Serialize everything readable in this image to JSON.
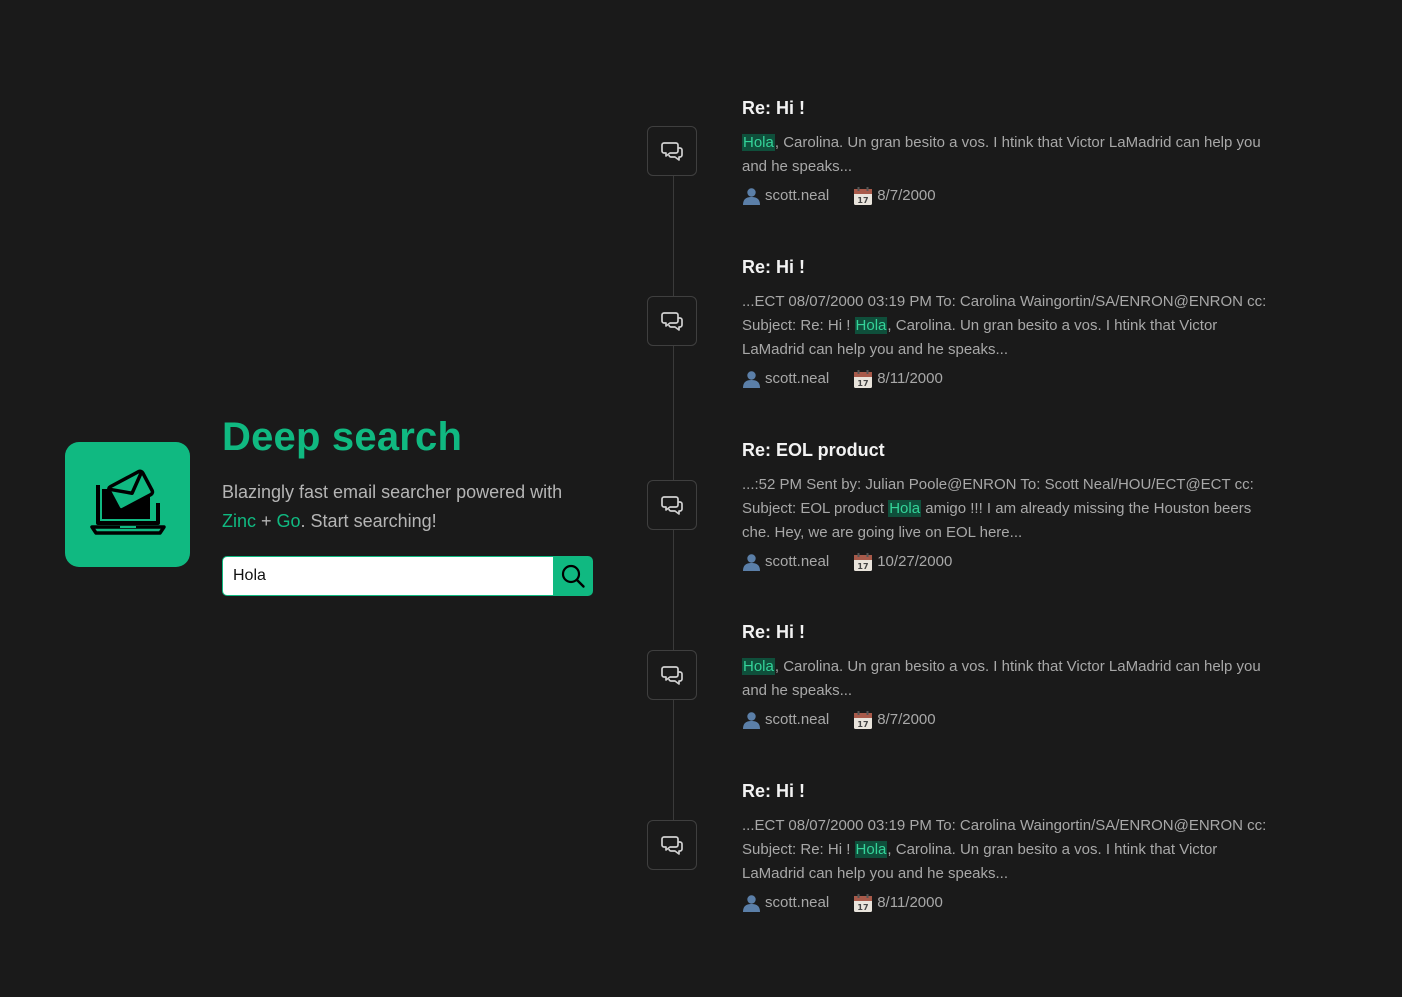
{
  "hero": {
    "title": "Deep search",
    "subtitle_pre": "Blazingly fast email searcher powered with ",
    "link_zinc": "Zinc",
    "plus": " + ",
    "link_go": "Go",
    "subtitle_post": ". Start searching!",
    "logo_icon": "laptop-mail-icon"
  },
  "search": {
    "value": "Hola",
    "button_icon": "search-icon"
  },
  "colors": {
    "accent": "#10b981",
    "background": "#1a1a1a",
    "highlight_bg": "#0f4f3b"
  },
  "results": [
    {
      "title": "Re: Hi !",
      "body_pre": "",
      "highlight": "Hola",
      "body_post": ", Carolina. Un gran besito a vos. I htink that Victor LaMadrid can help you and he speaks...",
      "author": "scott.neal",
      "date": "8/7/2000"
    },
    {
      "title": "Re: Hi !",
      "body_pre": "...ECT 08/07/2000 03:19 PM To: Carolina Waingortin/SA/ENRON@ENRON cc: Subject: Re: Hi ! ",
      "highlight": "Hola",
      "body_post": ", Carolina. Un gran besito a vos. I htink that Victor LaMadrid can help you and he speaks...",
      "author": "scott.neal",
      "date": "8/11/2000"
    },
    {
      "title": "Re: EOL product",
      "body_pre": "...:52 PM Sent by: Julian Poole@ENRON To: Scott Neal/HOU/ECT@ECT cc: Subject: EOL product ",
      "highlight": "Hola",
      "body_post": " amigo !!! I am already missing the Houston beers che. Hey, we are going live on EOL here...",
      "author": "scott.neal",
      "date": "10/27/2000"
    },
    {
      "title": "Re: Hi !",
      "body_pre": "",
      "highlight": "Hola",
      "body_post": ", Carolina. Un gran besito a vos. I htink that Victor LaMadrid can help you and he speaks...",
      "author": "scott.neal",
      "date": "8/7/2000"
    },
    {
      "title": "Re: Hi !",
      "body_pre": "...ECT 08/07/2000 03:19 PM To: Carolina Waingortin/SA/ENRON@ENRON cc: Subject: Re: Hi ! ",
      "highlight": "Hola",
      "body_post": ", Carolina. Un gran besito a vos. I htink that Victor LaMadrid can help you and he speaks...",
      "author": "scott.neal",
      "date": "8/11/2000"
    }
  ]
}
